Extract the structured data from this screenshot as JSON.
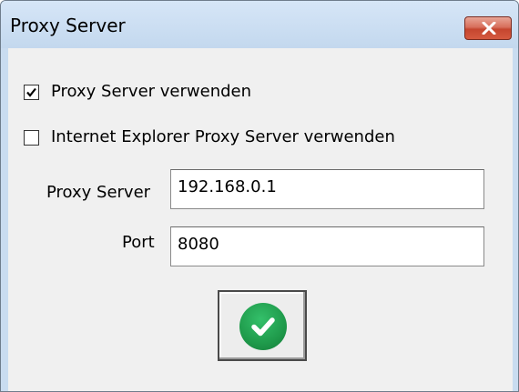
{
  "window": {
    "title": "Proxy Server"
  },
  "options": {
    "use_proxy": {
      "label": "Proxy Server verwenden",
      "checked": true
    },
    "use_ie_proxy": {
      "label": "Internet Explorer Proxy Server verwenden",
      "checked": false
    }
  },
  "fields": {
    "proxy_server": {
      "label": "Proxy Server",
      "value": "192.168.0.1"
    },
    "port": {
      "label": "Port",
      "value": "8080"
    }
  },
  "icons": {
    "close": "close-icon",
    "ok": "checkmark-icon"
  },
  "colors": {
    "titlebar": "#c9dcf0",
    "close_button": "#c5452f",
    "ok_green": "#1f9a4b"
  }
}
